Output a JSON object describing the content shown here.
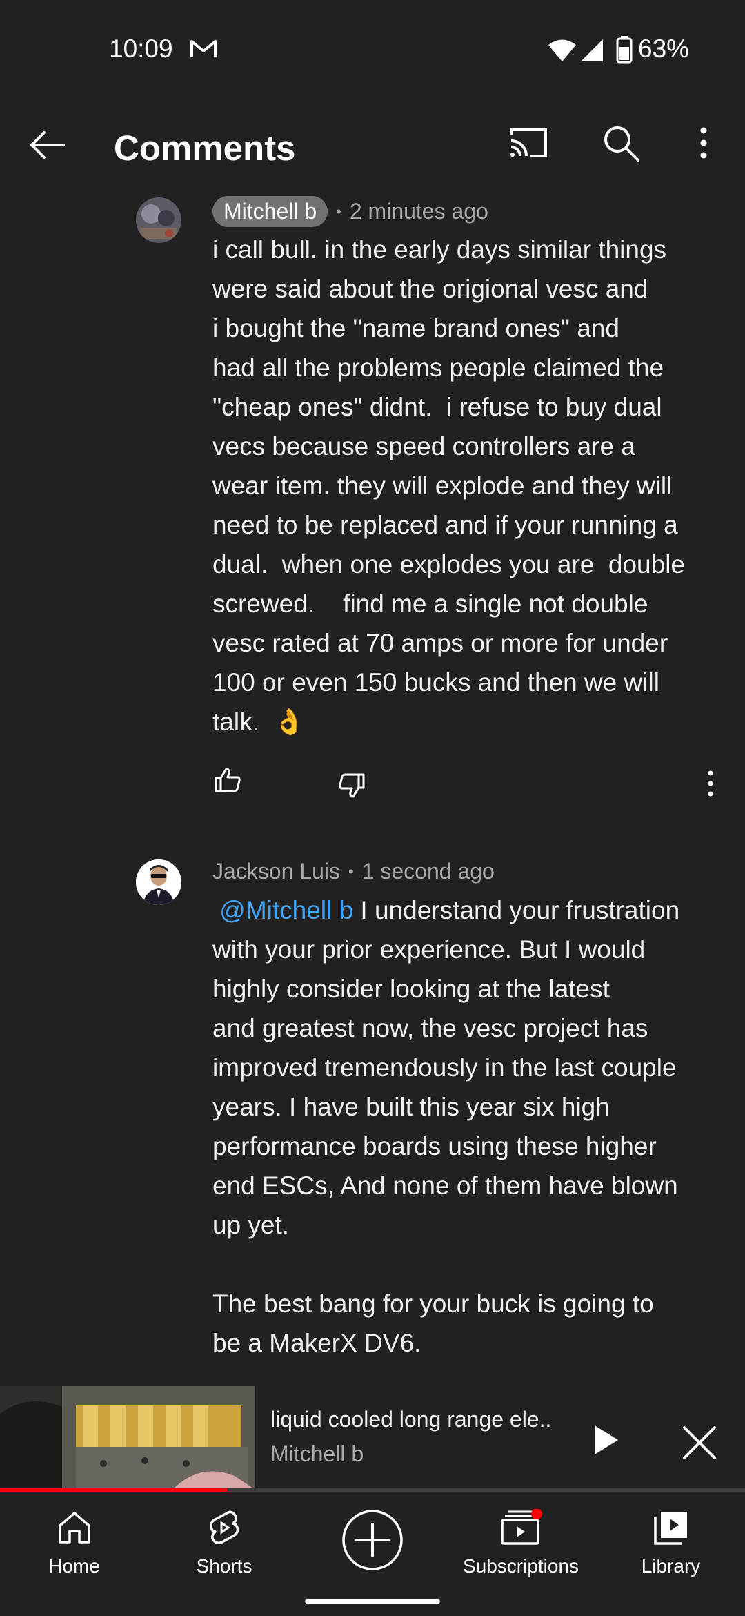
{
  "status_bar": {
    "time": "10:09",
    "battery": "63%"
  },
  "header": {
    "title": "Comments",
    "icons": [
      "back-arrow-icon",
      "cast-icon",
      "search-icon",
      "more-vert-icon"
    ]
  },
  "comments": [
    {
      "author": "Mitchell b",
      "time": "2 minutes ago",
      "text_lines": [
        "i call bull. in the early days similar things",
        "were said about the origional vesc and",
        "i bought the \"name brand ones\" and",
        "had all the problems people claimed the",
        "\"cheap ones\" didnt.  i refuse to buy dual",
        "vecs because speed controllers are a",
        "wear item. they will explode and they will",
        "need to be replaced and if your running a",
        "dual.  when one explodes you are  double",
        "screwed.    find me a single not double",
        "vesc rated at 70 amps or more for under",
        "100 or even 150 bucks and then we will",
        "talk.  👌"
      ]
    },
    {
      "author": "Jackson Luis",
      "time": "1 second ago",
      "mention": "@Mitchell b",
      "first_line_rest": " I understand your frustration",
      "text_lines": [
        "with your prior experience. But I would",
        "highly consider looking at the latest",
        "and greatest now, the vesc project has",
        "improved tremendously in the last couple",
        "years. I have built this year six high",
        "performance boards using these higher",
        "end ESCs, And none of them have blown",
        "up yet.",
        "",
        "The best bang for your buck is going to",
        "be a MakerX DV6."
      ]
    }
  ],
  "mini_player": {
    "title": "liquid cooled long range ele..",
    "channel": "Mitchell b",
    "progress": 0.305
  },
  "bottom_nav": {
    "home": "Home",
    "shorts": "Shorts",
    "subscriptions": "Subscriptions",
    "library": "Library"
  },
  "colors": {
    "background": "#212121",
    "mention": "#3ea6ff",
    "progress": "#ff0000",
    "notification_dot": "#ff0000"
  }
}
